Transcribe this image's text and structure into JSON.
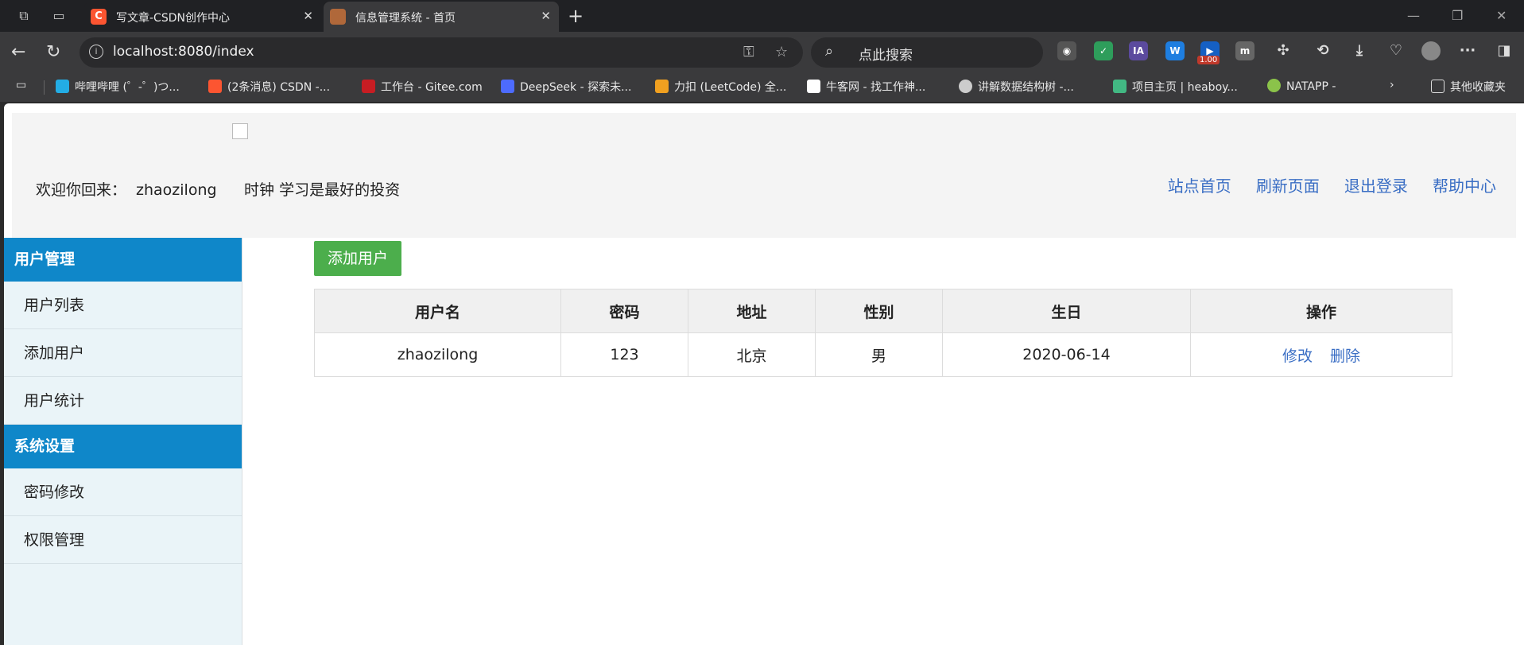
{
  "browser": {
    "tabs": [
      {
        "title": "写文章-CSDN创作中心",
        "icon": "csdn-icon",
        "color": "#fc5531",
        "active": false
      },
      {
        "title": "信息管理系统 - 首页",
        "icon": "site-icon",
        "color": "#b0683a",
        "active": true
      }
    ],
    "address": "localhost:8080/index",
    "search_placeholder": "点此搜索",
    "extension_badge": "1.00",
    "bookmarks": [
      {
        "label": "哔哩哔哩 (゜-゜)つ...",
        "icon": "bilibili-icon",
        "color": "#23ade5"
      },
      {
        "label": "(2条消息) CSDN -...",
        "icon": "csdn-icon",
        "color": "#fc5531"
      },
      {
        "label": "工作台 - Gitee.com",
        "icon": "gitee-icon",
        "color": "#c71d23"
      },
      {
        "label": "DeepSeek - 探索未...",
        "icon": "deepseek-icon",
        "color": "#4d6bfe"
      },
      {
        "label": "力扣 (LeetCode) 全...",
        "icon": "leetcode-icon",
        "color": "#f0a020"
      },
      {
        "label": "牛客网 - 找工作神...",
        "icon": "nowcoder-icon",
        "color": "#ffffff"
      },
      {
        "label": "讲解数据结构树 -...",
        "icon": "avatar-icon",
        "color": "#cccccc"
      },
      {
        "label": "项目主页 | heaboy...",
        "icon": "vue-icon",
        "color": "#42b883"
      },
      {
        "label": "NATAPP -",
        "icon": "natapp-icon",
        "color": "#8bc34a"
      }
    ],
    "other_bookmarks": "其他收藏夹"
  },
  "header": {
    "welcome_label": "欢迎你回来：",
    "username": "zhaozilong",
    "clock_label": "时钟",
    "motto": "学习是最好的投资",
    "links": [
      "站点首页",
      "刷新页面",
      "退出登录",
      "帮助中心"
    ]
  },
  "sidebar": {
    "sections": [
      {
        "title": "用户管理",
        "items": [
          "用户列表",
          "添加用户",
          "用户统计"
        ]
      },
      {
        "title": "系统设置",
        "items": [
          "密码修改",
          "权限管理"
        ]
      }
    ]
  },
  "main": {
    "add_button": "添加用户",
    "columns": [
      "用户名",
      "密码",
      "地址",
      "性别",
      "生日",
      "操作"
    ],
    "rows": [
      {
        "username": "zhaozilong",
        "password": "123",
        "address": "北京",
        "gender": "男",
        "birthday": "2020-06-14",
        "edit": "修改",
        "delete": "删除"
      }
    ]
  },
  "colors": {
    "sidebar_header": "#0f87c9",
    "add_button": "#4cae4c",
    "link": "#3a6ec4"
  }
}
